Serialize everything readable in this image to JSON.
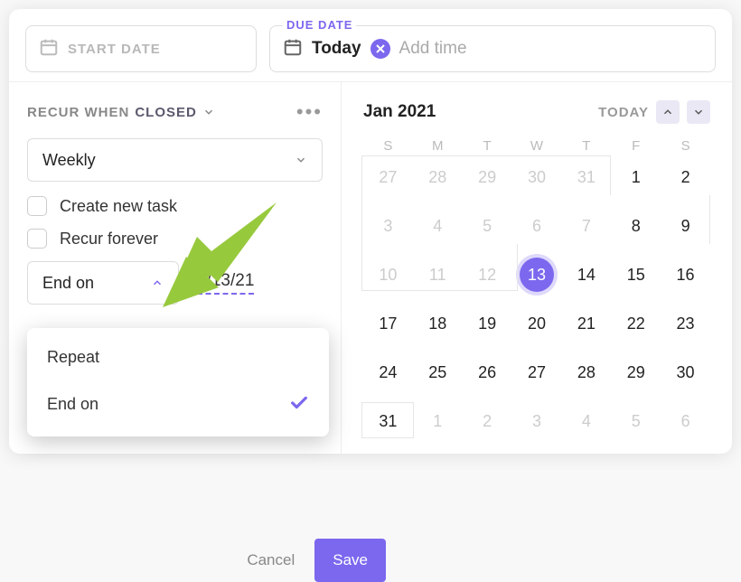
{
  "header": {
    "start_placeholder": "START DATE",
    "due_label": "DUE DATE",
    "due_value": "Today",
    "add_time": "Add time"
  },
  "recur": {
    "prefix": "RECUR WHEN",
    "state": "CLOSED",
    "frequency": "Weekly",
    "create_new_task": "Create new task",
    "recur_forever": "Recur forever",
    "end_mode": "End on",
    "end_date": "1/13/21"
  },
  "dropdown": {
    "items": [
      {
        "label": "Repeat",
        "selected": false
      },
      {
        "label": "End on",
        "selected": true
      }
    ]
  },
  "footer": {
    "cancel": "Cancel",
    "save": "Save"
  },
  "calendar": {
    "month": "Jan 2021",
    "today_label": "TODAY",
    "dow": [
      "S",
      "M",
      "T",
      "W",
      "T",
      "F",
      "S"
    ],
    "selected_day": 13,
    "weeks": [
      [
        {
          "d": 27,
          "m": true
        },
        {
          "d": 28,
          "m": true
        },
        {
          "d": 29,
          "m": true
        },
        {
          "d": 30,
          "m": true
        },
        {
          "d": 31,
          "m": true
        },
        {
          "d": 1
        },
        {
          "d": 2
        }
      ],
      [
        {
          "d": 3,
          "m": true
        },
        {
          "d": 4,
          "m": true
        },
        {
          "d": 5,
          "m": true
        },
        {
          "d": 6,
          "m": true
        },
        {
          "d": 7,
          "m": true
        },
        {
          "d": 8
        },
        {
          "d": 9
        }
      ],
      [
        {
          "d": 10,
          "m": true
        },
        {
          "d": 11,
          "m": true
        },
        {
          "d": 12,
          "m": true
        },
        {
          "d": 13,
          "sel": true
        },
        {
          "d": 14
        },
        {
          "d": 15
        },
        {
          "d": 16
        }
      ],
      [
        {
          "d": 17
        },
        {
          "d": 18
        },
        {
          "d": 19
        },
        {
          "d": 20
        },
        {
          "d": 21
        },
        {
          "d": 22
        },
        {
          "d": 23
        }
      ],
      [
        {
          "d": 24
        },
        {
          "d": 25
        },
        {
          "d": 26
        },
        {
          "d": 27
        },
        {
          "d": 28
        },
        {
          "d": 29
        },
        {
          "d": 30
        }
      ],
      [
        {
          "d": 31
        },
        {
          "d": 1,
          "m": true
        },
        {
          "d": 2,
          "m": true
        },
        {
          "d": 3,
          "m": true
        },
        {
          "d": 4,
          "m": true
        },
        {
          "d": 5,
          "m": true
        },
        {
          "d": 6,
          "m": true
        }
      ]
    ]
  },
  "colors": {
    "accent": "#7b68ee",
    "arrow": "#8bc34a"
  }
}
